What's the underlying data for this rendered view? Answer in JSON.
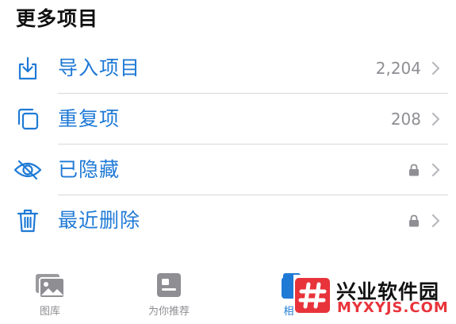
{
  "section": {
    "title": "更多项目"
  },
  "items": [
    {
      "label": "导入项目",
      "count": "2,204",
      "icon": "import-icon",
      "locked": false
    },
    {
      "label": "重复项",
      "count": "208",
      "icon": "duplicates-icon",
      "locked": false
    },
    {
      "label": "已隐藏",
      "count": "",
      "icon": "eye-slash-icon",
      "locked": true
    },
    {
      "label": "最近删除",
      "count": "",
      "icon": "trash-icon",
      "locked": true
    }
  ],
  "tabbar": {
    "tabs": [
      {
        "label": "图库",
        "icon": "photo-library-icon",
        "active": false
      },
      {
        "label": "为你推荐",
        "icon": "for-you-icon",
        "active": false
      },
      {
        "label": "相",
        "icon": "albums-icon",
        "active": true
      }
    ]
  },
  "watermark": {
    "title": "兴业软件园",
    "subtitle": "MYXYJS.COM"
  },
  "colors": {
    "accent": "#1f7ad6",
    "secondary_text": "#8e8e93",
    "watermark_red": "#e8333a"
  }
}
